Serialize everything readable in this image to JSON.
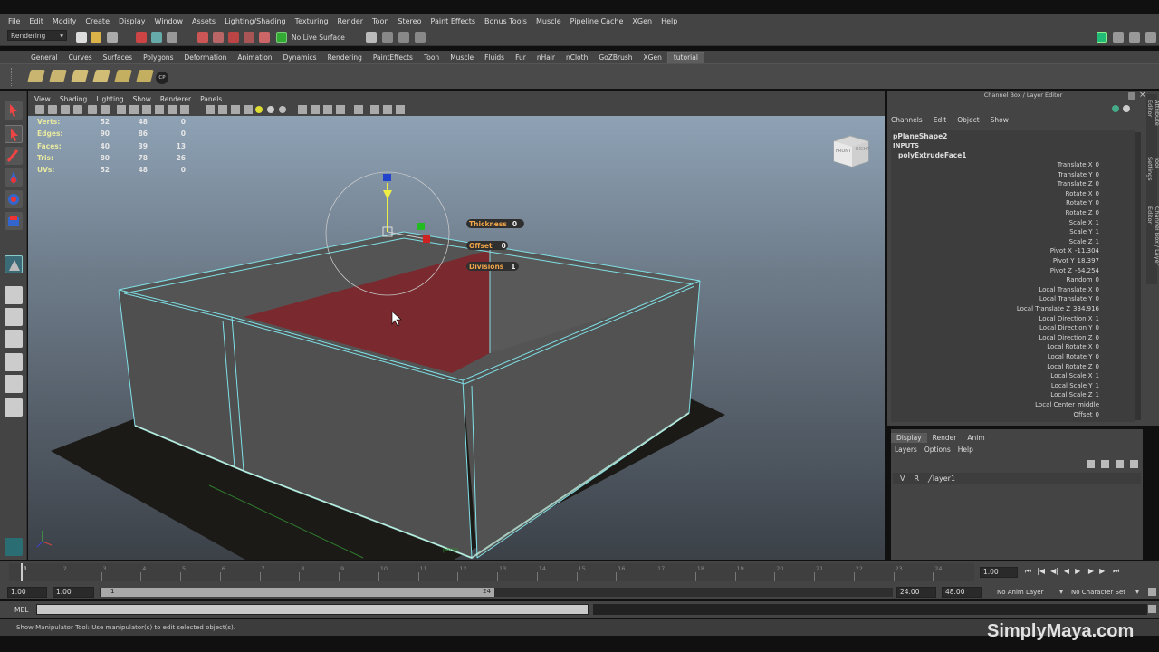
{
  "menubar": [
    "File",
    "Edit",
    "Modify",
    "Create",
    "Display",
    "Window",
    "Assets",
    "Lighting/Shading",
    "Texturing",
    "Render",
    "Toon",
    "Stereo",
    "Paint Effects",
    "Bonus Tools",
    "Muscle",
    "Pipeline Cache",
    "XGen",
    "Help"
  ],
  "status": {
    "menuset": "Rendering",
    "live_surface": "No Live Surface"
  },
  "shelf_tabs": [
    "General",
    "Curves",
    "Surfaces",
    "Polygons",
    "Deformation",
    "Animation",
    "Dynamics",
    "Rendering",
    "PaintEffects",
    "Toon",
    "Muscle",
    "Fluids",
    "Fur",
    "nHair",
    "nCloth",
    "GoZBrush",
    "XGen",
    "tutorial"
  ],
  "shelf_active": "tutorial",
  "shelf_icon_label": "CP",
  "panel_menu": [
    "View",
    "Shading",
    "Lighting",
    "Show",
    "Renderer",
    "Panels"
  ],
  "hud": {
    "rows": [
      {
        "label": "Verts:",
        "a": "52",
        "b": "48",
        "c": "0"
      },
      {
        "label": "Edges:",
        "a": "90",
        "b": "86",
        "c": "0"
      },
      {
        "label": "Faces:",
        "a": "40",
        "b": "39",
        "c": "13"
      },
      {
        "label": "Tris:",
        "a": "80",
        "b": "78",
        "c": "26"
      },
      {
        "label": "UVs:",
        "a": "52",
        "b": "48",
        "c": "0"
      }
    ],
    "thickness": {
      "label": "Thickness",
      "value": "0"
    },
    "offset": {
      "label": "Offset",
      "value": "0"
    },
    "divisions": {
      "label": "Divisions",
      "value": "1"
    },
    "viewcube_front": "FRONT",
    "viewcube_right": "RIGHT",
    "camera": "persp"
  },
  "channelbox": {
    "title": "Channel Box / Layer Editor",
    "menu": [
      "Channels",
      "Edit",
      "Object",
      "Show"
    ],
    "shape": "pPlaneShape2",
    "inputs": "INPUTS",
    "node": "polyExtrudeFace1",
    "attrs": [
      {
        "n": "Translate X",
        "v": "0"
      },
      {
        "n": "Translate Y",
        "v": "0"
      },
      {
        "n": "Translate Z",
        "v": "0"
      },
      {
        "n": "Rotate X",
        "v": "0"
      },
      {
        "n": "Rotate Y",
        "v": "0"
      },
      {
        "n": "Rotate Z",
        "v": "0"
      },
      {
        "n": "Scale X",
        "v": "1"
      },
      {
        "n": "Scale Y",
        "v": "1"
      },
      {
        "n": "Scale Z",
        "v": "1"
      },
      {
        "n": "Pivot X",
        "v": "-11.304"
      },
      {
        "n": "Pivot Y",
        "v": "18.397"
      },
      {
        "n": "Pivot Z",
        "v": "-64.254"
      },
      {
        "n": "Random",
        "v": "0"
      },
      {
        "n": "Local Translate X",
        "v": "0"
      },
      {
        "n": "Local Translate Y",
        "v": "0"
      },
      {
        "n": "Local Translate Z",
        "v": "334.916"
      },
      {
        "n": "Local Direction X",
        "v": "1"
      },
      {
        "n": "Local Direction Y",
        "v": "0"
      },
      {
        "n": "Local Direction Z",
        "v": "0"
      },
      {
        "n": "Local Rotate X",
        "v": "0"
      },
      {
        "n": "Local Rotate Y",
        "v": "0"
      },
      {
        "n": "Local Rotate Z",
        "v": "0"
      },
      {
        "n": "Local Scale X",
        "v": "1"
      },
      {
        "n": "Local Scale Y",
        "v": "1"
      },
      {
        "n": "Local Scale Z",
        "v": "1"
      },
      {
        "n": "Local Center",
        "v": "middle"
      },
      {
        "n": "Offset",
        "v": "0"
      }
    ],
    "side_tabs": [
      "Attribute Editor",
      "Tool Settings",
      "Channel Box / Layer Editor"
    ]
  },
  "layers": {
    "tabs": [
      "Display",
      "Render",
      "Anim"
    ],
    "menu": [
      "Layers",
      "Options",
      "Help"
    ],
    "row": {
      "v": "V",
      "r": "R",
      "name": "layer1"
    }
  },
  "timeline": {
    "ticks": [
      "1",
      "2",
      "3",
      "4",
      "5",
      "6",
      "7",
      "8",
      "9",
      "10",
      "11",
      "12",
      "13",
      "14",
      "15",
      "16",
      "17",
      "18",
      "19",
      "20",
      "21",
      "22",
      "23",
      "24"
    ],
    "current": "1.00"
  },
  "range": {
    "start": "1.00",
    "inner_start": "1.00",
    "slider_start": "1",
    "slider_end": "24",
    "inner_end": "24.00",
    "end": "48.00",
    "anim_layer": "No Anim Layer",
    "char_set": "No Character Set"
  },
  "cmd": {
    "label": "MEL"
  },
  "help": {
    "text": "Show Manipulator Tool: Use manipulator(s) to edit selected object(s)."
  },
  "watermark": "SimplyMaya.com",
  "colors": {
    "selected_face": "#7a2a2e",
    "wire": "#7fe0e6",
    "hud_label": "#e9e9a0"
  }
}
